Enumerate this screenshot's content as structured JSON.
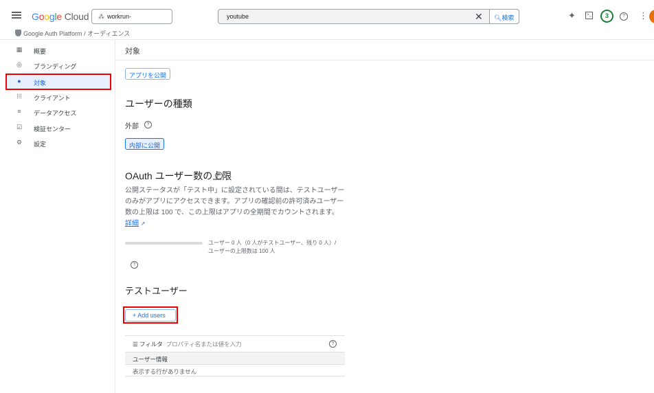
{
  "header": {
    "logo": "Google Cloud",
    "project": "workrun-",
    "search_value": "youtube",
    "search_button": "検索",
    "notification_count": "3"
  },
  "breadcrumb": {
    "platform": "Google Auth Platform",
    "separator": "/",
    "page": "オーディエンス"
  },
  "sidebar": {
    "items": [
      {
        "label": "概要",
        "icon": "dashboard-icon"
      },
      {
        "label": "ブランディング",
        "icon": "palette-icon"
      },
      {
        "label": "対象",
        "icon": "account-circle-icon",
        "selected": true
      },
      {
        "label": "クライアント",
        "icon": "grid-icon"
      },
      {
        "label": "データアクセス",
        "icon": "data-settings-icon"
      },
      {
        "label": "検証センター",
        "icon": "verify-icon"
      },
      {
        "label": "設定",
        "icon": "gear-icon"
      }
    ]
  },
  "main": {
    "title": "対象",
    "publish_button": "アプリを公開",
    "user_type_heading": "ユーザーの種類",
    "user_type_value": "外部",
    "make_internal_button": "内部に公開",
    "oauth_heading": "OAuth ユーザー数の上限",
    "oauth_description": "公開ステータスが「テスト中」に設定されている間は、テストユーザーのみがアプリにアクセスできます。アプリの確認前の許可済みユーザー数の上限は 100 で、この上限はアプリの全期間でカウントされます。",
    "learn_more": "詳細",
    "usage_progress": 0,
    "usage_text": "ユーザー 0 人（0 人がテストユーザー、残り 0 人）/ ユーザーの上限数は 100 人",
    "test_users_heading": "テストユーザー",
    "add_users_button": "+ Add users",
    "filter_label": "フィルタ",
    "filter_placeholder": "プロパティ名または値を入力",
    "table_header": "ユーザー情報",
    "empty_message": "表示する行がありません"
  },
  "colors": {
    "accent": "#1a73e8",
    "highlight": "#e00000",
    "selected_bg": "#e8f0fe"
  }
}
